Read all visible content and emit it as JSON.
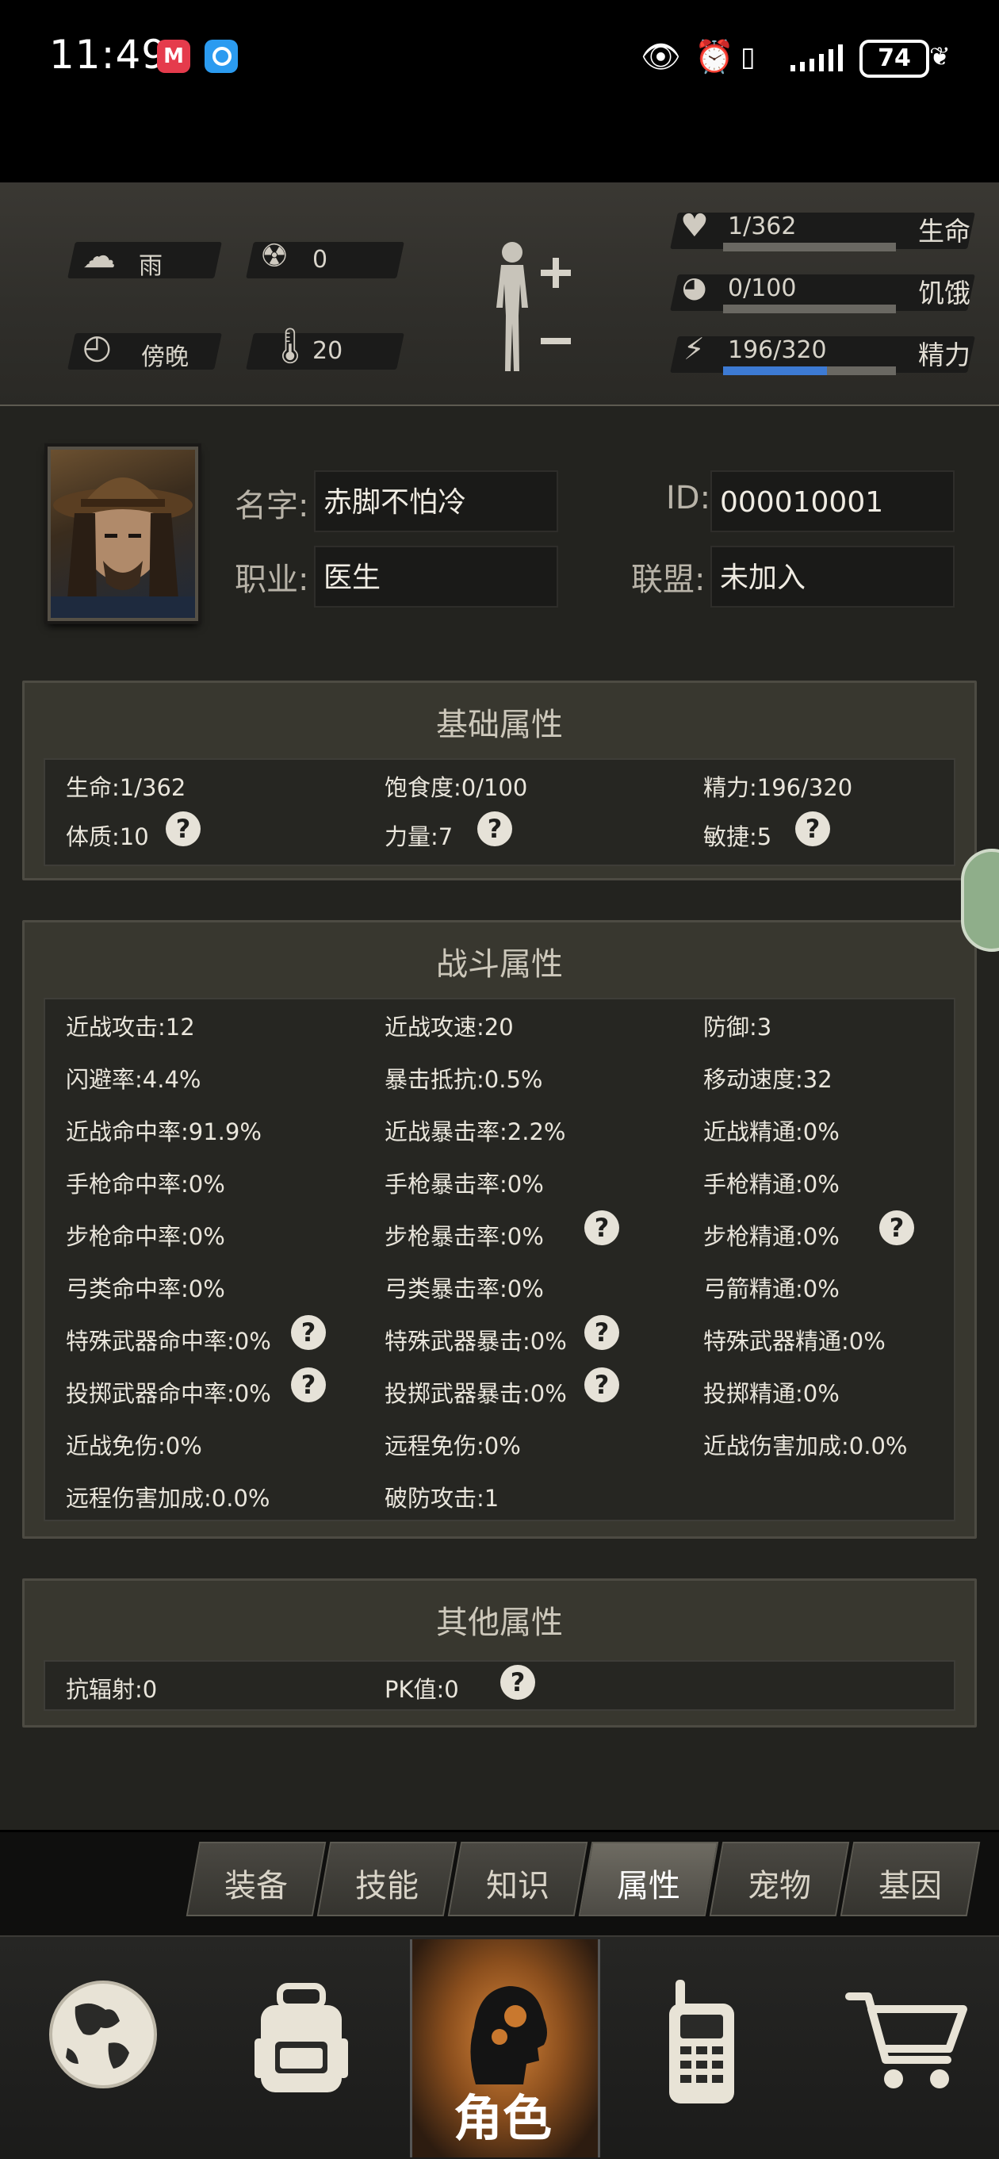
{
  "status_bar": {
    "time": "11:49",
    "app1_glyph": "M",
    "battery": "74"
  },
  "header": {
    "weather": "雨",
    "radiation": "0",
    "time_of_day": "傍晚",
    "temperature": "20",
    "stats": [
      {
        "value": "1/362",
        "label": "生命",
        "fill": 0.003,
        "icon": "heart-icon"
      },
      {
        "value": "0/100",
        "label": "饥饿",
        "fill": 0.0,
        "icon": "stomach-icon"
      },
      {
        "value": "196/320",
        "label": "精力",
        "fill": 0.6,
        "icon": "energy-icon"
      }
    ]
  },
  "profile": {
    "name_label": "名字",
    "name": "赤脚不怕冷",
    "id_label": "ID",
    "id": "000010001",
    "job_label": "职业",
    "job": "医生",
    "alliance_label": "联盟",
    "alliance": "未加入"
  },
  "basic": {
    "title": "基础属性",
    "items": [
      "生命:1/362",
      "饱食度:0/100",
      "精力:196/320",
      "体质:10",
      "力量:7",
      "敏捷:5"
    ]
  },
  "combat": {
    "title": "战斗属性",
    "items": [
      "近战攻击:12",
      "近战攻速:20",
      "防御:3",
      "闪避率:4.4%",
      "暴击抵抗:0.5%",
      "移动速度:32",
      "近战命中率:91.9%",
      "近战暴击率:2.2%",
      "近战精通:0%",
      "手枪命中率:0%",
      "手枪暴击率:0%",
      "手枪精通:0%",
      "步枪命中率:0%",
      "步枪暴击率:0%",
      "步枪精通:0%",
      "弓类命中率:0%",
      "弓类暴击率:0%",
      "弓箭精通:0%",
      "特殊武器命中率:0%",
      "特殊武器暴击:0%",
      "特殊武器精通:0%",
      "投掷武器命中率:0%",
      "投掷武器暴击:0%",
      "投掷精通:0%",
      "近战免伤:0%",
      "远程免伤:0%",
      "近战伤害加成:0.0%",
      "远程伤害加成:0.0%",
      "破防攻击:1"
    ]
  },
  "other": {
    "title": "其他属性",
    "items": [
      "抗辐射:0",
      "PK值:0"
    ]
  },
  "help_glyph": "?",
  "tabs": [
    "装备",
    "技能",
    "知识",
    "属性",
    "宠物",
    "基因"
  ],
  "active_tab": "属性",
  "bottom_nav": {
    "active_label": "角色",
    "items": [
      "world-map-icon",
      "backpack-icon",
      "character-icon",
      "radio-icon",
      "shop-cart-icon"
    ]
  },
  "colors": {
    "energy_bar": "#3d7ad3",
    "panel_bg": "#23231f",
    "section_bg": "#38372f",
    "active_nav": "#d8863a"
  }
}
